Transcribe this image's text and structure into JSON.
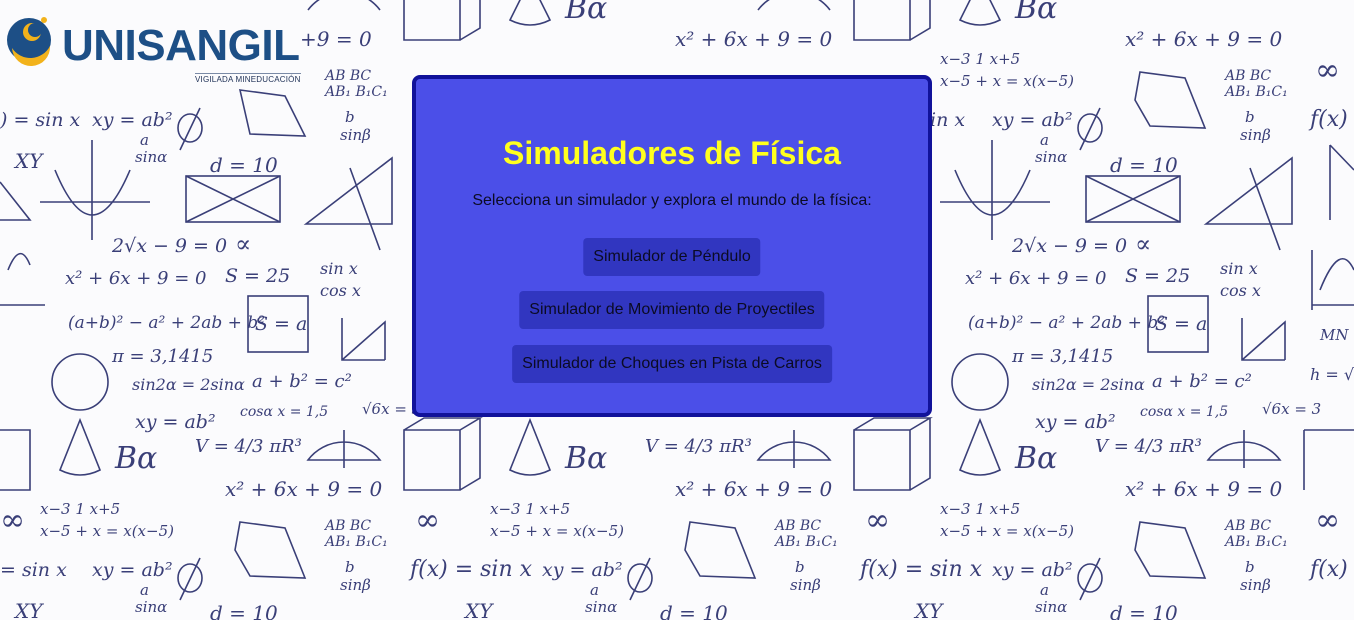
{
  "logo": {
    "name": "UNISANGIL",
    "tagline": "VIGILADA MINEDUCACIÓN",
    "colors": {
      "blue": "#1d4f86",
      "gold": "#f2b21b"
    }
  },
  "panel": {
    "title": "Simuladores de Física",
    "subtitle": "Selecciona un simulador y explora el mundo de la física:",
    "buttons": [
      {
        "label": "Simulador de Péndulo"
      },
      {
        "label": "Simulador de Movimiento de Proyectiles"
      },
      {
        "label": "Simulador de Choques en Pista de Carros"
      }
    ],
    "colors": {
      "background": "#4b4fe8",
      "border": "#11129a",
      "title": "#ffff1e",
      "button": "#3136c0"
    }
  },
  "background": {
    "formulas": [
      "+9=0",
      "x² + 6x + 9 = 0",
      "(x−3)/(x−5) + 1/x = (x+5)/(x(x−5))",
      "AB/AB₁ = BC/B₁C₁",
      "f(x) = sin x",
      "xy = ab²",
      "a/sinα",
      "b/sinβ",
      "d = 10",
      "2√x − 9 = 0",
      "S = 25",
      "sin x / cos x",
      "(a+b)² − a² + 2ab + b²",
      "S = a",
      "π = 3,1415",
      "sin2α = 2sinα",
      "a + b² = c²",
      "cosα",
      "x = 1,5",
      "√6x = 3",
      "V = 4/3 πR³",
      "MN =",
      "h = √a",
      "BC",
      "Bα"
    ]
  }
}
